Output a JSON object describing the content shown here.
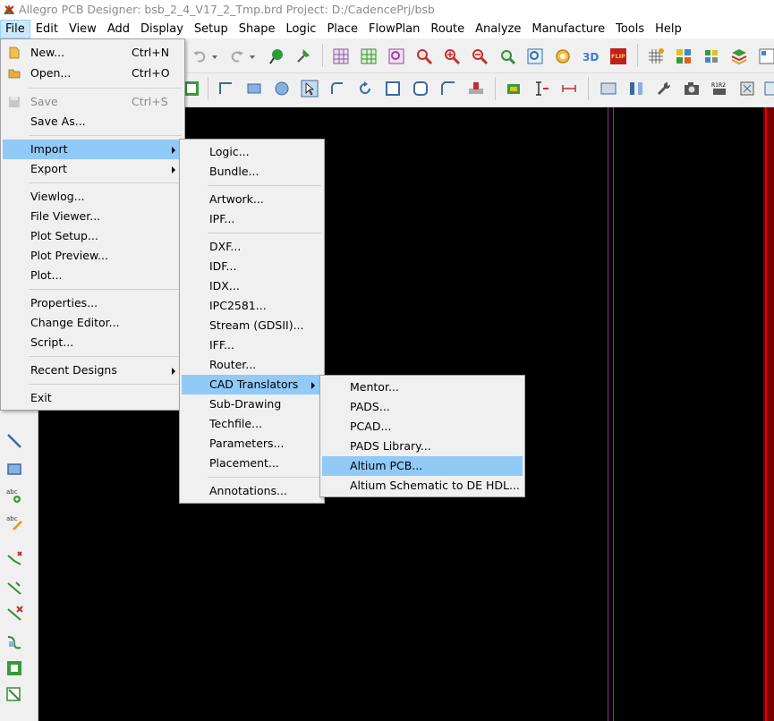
{
  "window": {
    "title": "Allegro PCB Designer: bsb_2_4_V17_2_Tmp.brd  Project: D:/CadencePrj/bsb"
  },
  "menubar": {
    "items": [
      "File",
      "Edit",
      "View",
      "Add",
      "Display",
      "Setup",
      "Shape",
      "Logic",
      "Place",
      "FlowPlan",
      "Route",
      "Analyze",
      "Manufacture",
      "Tools",
      "Help"
    ],
    "active": "File"
  },
  "file_menu": {
    "new": {
      "label": "New...",
      "shortcut": "Ctrl+N"
    },
    "open": {
      "label": "Open...",
      "shortcut": "Ctrl+O"
    },
    "save": {
      "label": "Save",
      "shortcut": "Ctrl+S"
    },
    "save_as": {
      "label": "Save As..."
    },
    "import": {
      "label": "Import"
    },
    "export": {
      "label": "Export"
    },
    "viewlog": {
      "label": "Viewlog..."
    },
    "file_viewer": {
      "label": "File Viewer..."
    },
    "plot_setup": {
      "label": "Plot Setup..."
    },
    "plot_preview": {
      "label": "Plot Preview..."
    },
    "plot": {
      "label": "Plot..."
    },
    "properties": {
      "label": "Properties..."
    },
    "change_editor": {
      "label": "Change Editor..."
    },
    "script": {
      "label": "Script..."
    },
    "recent_designs": {
      "label": "Recent Designs"
    },
    "exit": {
      "label": "Exit"
    }
  },
  "import_menu": {
    "items": [
      "Logic...",
      "Bundle...",
      "Artwork...",
      "IPF...",
      "DXF...",
      "IDF...",
      "IDX...",
      "IPC2581...",
      "Stream (GDSII)...",
      "IFF...",
      "Router...",
      "CAD Translators",
      "Sub-Drawing",
      "Techfile...",
      "Parameters...",
      "Placement...",
      "Annotations..."
    ],
    "highlighted": "CAD Translators"
  },
  "cad_translators_menu": {
    "items": [
      "Mentor...",
      "PADS...",
      "PCAD...",
      "PADS Library...",
      "Altium PCB...",
      "Altium Schematic to DE HDL..."
    ],
    "highlighted": "Altium PCB..."
  },
  "toolbar": {
    "flip_badge": "FLIP",
    "ref_badge": "R1R2"
  },
  "colors": {
    "canvas": "#000000",
    "menu_highlight": "#91c9f7",
    "menubar_active": "#cce8ff",
    "guide_line": "#a020a0",
    "board_edge": "#c00000"
  }
}
